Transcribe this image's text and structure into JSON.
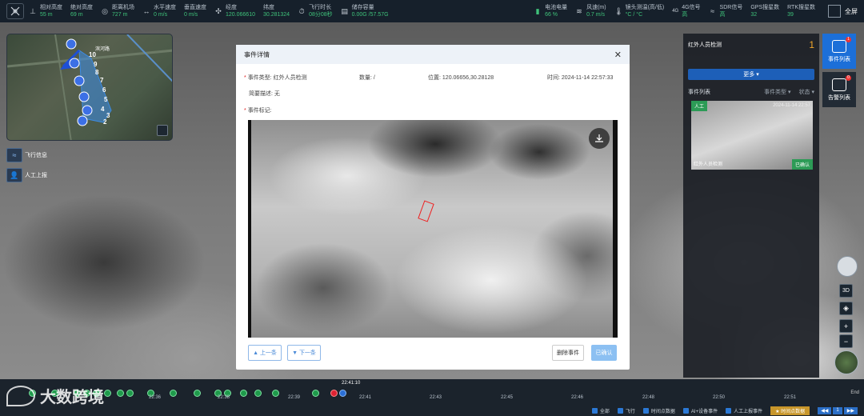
{
  "topbar": {
    "items": [
      {
        "label": "相对高度",
        "value": "55 m",
        "icon": "altitude-icon"
      },
      {
        "label": "绝对高度",
        "value": "69 m",
        "icon": "altitude-icon"
      },
      {
        "label": "距离机场",
        "value": "727 m",
        "icon": "distance-icon"
      },
      {
        "label": "水平速度",
        "value": "0 m/s",
        "icon": "speed-icon"
      },
      {
        "label": "垂直速度",
        "value": "0 m/s",
        "icon": "speed-icon"
      },
      {
        "label": "经度",
        "value": "120.066610",
        "icon": "drone-icon"
      },
      {
        "label": "纬度",
        "value": "30.281324",
        "icon": "drone-icon"
      },
      {
        "label": "飞行时长",
        "value": "08分08秒",
        "icon": "clock-icon"
      },
      {
        "label": "储存容量",
        "value": "0.00G /57.57G",
        "icon": "storage-icon"
      }
    ],
    "right_items": [
      {
        "label": "电池电量",
        "value": "66 %"
      },
      {
        "label": "风速(m)",
        "value": "0.7 m/s"
      },
      {
        "label": "镜头测温(高/低)",
        "value": "°C / °C"
      },
      {
        "label": "4G信号",
        "value": "高",
        "prefix": "4G"
      },
      {
        "label": "SDR信号",
        "value": "高"
      },
      {
        "label": "GPS搜星数",
        "value": "32"
      },
      {
        "label": "RTK搜星数",
        "value": "39"
      }
    ],
    "fullscreen": "全屏"
  },
  "side": {
    "flight_info": "飞行信息",
    "manual_report": "人工上报"
  },
  "minimap": {
    "waypoints": [
      "10",
      "9",
      "8",
      "7",
      "6",
      "5",
      "4",
      "3",
      "2",
      "1"
    ],
    "street": "滨河路"
  },
  "right_panel": {
    "title": "红外人员检测",
    "count": "1",
    "more": "更多",
    "list_title": "事件列表",
    "filter_type": "事件类型",
    "filter_status": "状态",
    "card": {
      "tag": "人工",
      "time": "2024-11-14 22:57",
      "name": "红外人员检测",
      "status": "已确认"
    }
  },
  "right_tabs": [
    {
      "label": "事件列表",
      "badge": "1"
    },
    {
      "label": "告警列表",
      "badge": "0"
    }
  ],
  "map_ctrl": {
    "view3d": "3D",
    "zoom_in": "+",
    "zoom_out": "−"
  },
  "modal": {
    "title": "事件详情",
    "type_label": "事件类型:",
    "type_value": "红外人员检测",
    "qty_label": "数量:",
    "qty_value": "/",
    "pos_label": "位置:",
    "pos_value": "120.06656,30.28128",
    "time_label": "时间:",
    "time_value": "2024-11-14 22:57:33",
    "desc_label": "简要描述:",
    "desc_value": "无",
    "mark_label": "事件标记:",
    "prev": "上一条",
    "next": "下一条",
    "delete": "删除事件",
    "confirm": "已确认"
  },
  "timeline": {
    "current": "22:41:10",
    "ticks": [
      "22:36",
      "22:38",
      "22:39",
      "22:41",
      "22:43",
      "22:45",
      "22:46",
      "22:48",
      "22:50",
      "22:51"
    ],
    "end": "End",
    "filters": [
      "全部",
      "飞行",
      "时间点数据",
      "AI+设备事件",
      "人工上报事件"
    ],
    "save": "时间点数据",
    "nav": [
      "◀◀",
      "1",
      "▶▶"
    ],
    "logo": "大数跨境"
  }
}
